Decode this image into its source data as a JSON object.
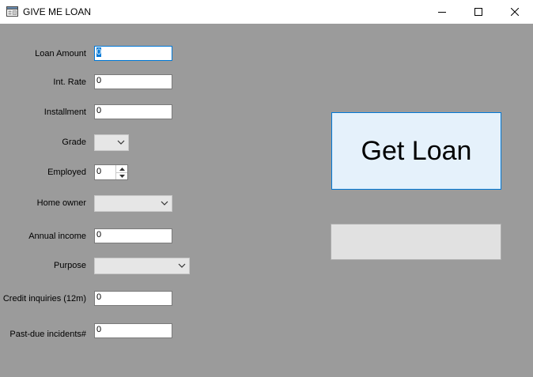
{
  "window": {
    "title": "GIVE ME LOAN",
    "icons": {
      "app": "app-form-icon",
      "minimize": "minimize-icon",
      "maximize": "maximize-icon",
      "close": "close-icon"
    }
  },
  "form": {
    "loan_amount": {
      "label": "Loan Amount",
      "value": "0"
    },
    "int_rate": {
      "label": "Int. Rate",
      "value": "0"
    },
    "installment": {
      "label": "Installment",
      "value": "0"
    },
    "grade": {
      "label": "Grade",
      "value": ""
    },
    "employed": {
      "label": "Employed",
      "value": "0"
    },
    "home_owner": {
      "label": "Home owner",
      "value": ""
    },
    "annual_income": {
      "label": "Annual income",
      "value": "0"
    },
    "purpose": {
      "label": "Purpose",
      "value": ""
    },
    "credit_inquiries": {
      "label": "Credit inquiries (12m)",
      "value": "0"
    },
    "past_due": {
      "label": "Past-due incidents#",
      "value": "0"
    }
  },
  "actions": {
    "get_loan_label": "Get Loan",
    "result_text": ""
  },
  "colors": {
    "client_bg": "#9b9b9b",
    "button_bg": "#e5f1fb",
    "focus_border": "#0078d7"
  }
}
